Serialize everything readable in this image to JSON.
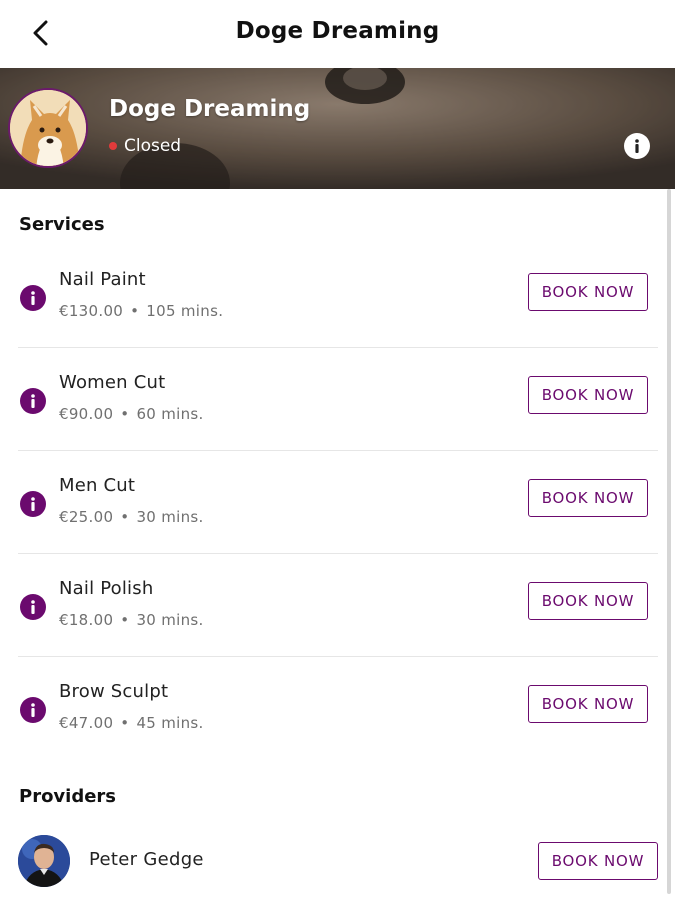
{
  "header": {
    "title": "Doge Dreaming",
    "back_icon": "chevron-left-icon"
  },
  "business": {
    "name": "Doge Dreaming",
    "status": "Closed",
    "status_color": "#e23b3b",
    "info_icon": "info-icon"
  },
  "services_section": {
    "title": "Services",
    "items": [
      {
        "name": "Nail Paint",
        "price": "€130.00",
        "separator": "•",
        "duration": "105 mins.",
        "button": "BOOK NOW"
      },
      {
        "name": "Women Cut",
        "price": "€90.00",
        "separator": "•",
        "duration": "60 mins.",
        "button": "BOOK NOW"
      },
      {
        "name": "Men Cut",
        "price": "€25.00",
        "separator": "•",
        "duration": "30 mins.",
        "button": "BOOK NOW"
      },
      {
        "name": "Nail Polish",
        "price": "€18.00",
        "separator": "•",
        "duration": "30 mins.",
        "button": "BOOK NOW"
      },
      {
        "name": "Brow Sculpt",
        "price": "€47.00",
        "separator": "•",
        "duration": "45 mins.",
        "button": "BOOK NOW"
      }
    ]
  },
  "providers_section": {
    "title": "Providers",
    "items": [
      {
        "name": "Peter Gedge",
        "button": "BOOK NOW"
      }
    ]
  },
  "colors": {
    "accent": "#6b0a6e",
    "status_closed": "#e23b3b",
    "muted_text": "#707070",
    "divider": "#e6e6e6"
  }
}
